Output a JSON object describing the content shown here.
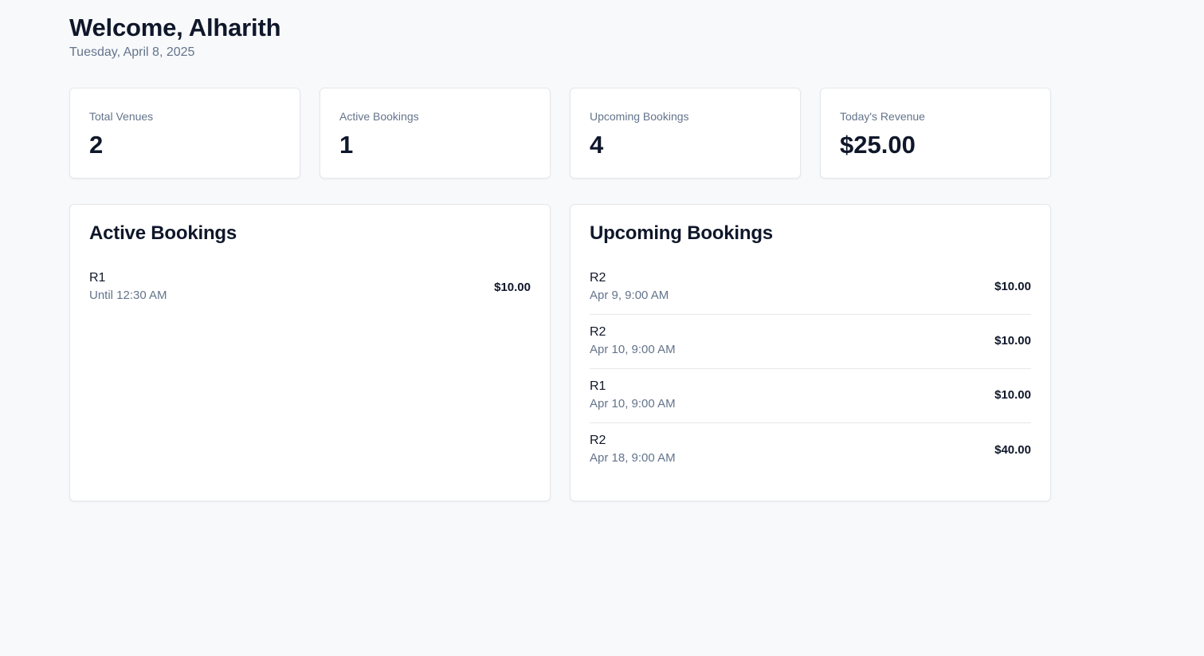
{
  "header": {
    "title": "Welcome, Alharith",
    "date": "Tuesday, April 8, 2025"
  },
  "stats": [
    {
      "label": "Total Venues",
      "value": "2"
    },
    {
      "label": "Active Bookings",
      "value": "1"
    },
    {
      "label": "Upcoming Bookings",
      "value": "4"
    },
    {
      "label": "Today's Revenue",
      "value": "$25.00"
    }
  ],
  "active_bookings": {
    "title": "Active Bookings",
    "items": [
      {
        "venue": "R1",
        "time": "Until 12:30 AM",
        "price": "$10.00"
      }
    ]
  },
  "upcoming_bookings": {
    "title": "Upcoming Bookings",
    "items": [
      {
        "venue": "R2",
        "time": "Apr 9, 9:00 AM",
        "price": "$10.00"
      },
      {
        "venue": "R2",
        "time": "Apr 10, 9:00 AM",
        "price": "$10.00"
      },
      {
        "venue": "R1",
        "time": "Apr 10, 9:00 AM",
        "price": "$10.00"
      },
      {
        "venue": "R2",
        "time": "Apr 18, 9:00 AM",
        "price": "$40.00"
      }
    ]
  }
}
